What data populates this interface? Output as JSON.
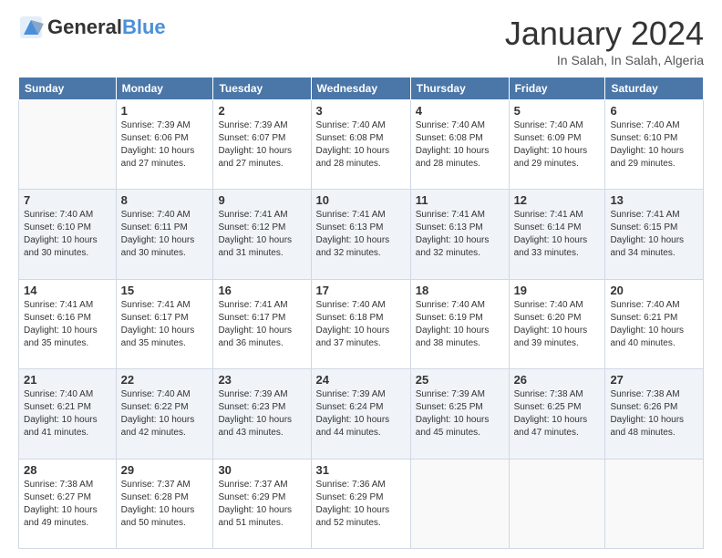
{
  "logo": {
    "text_general": "General",
    "text_blue": "Blue"
  },
  "header": {
    "title": "January 2024",
    "subtitle": "In Salah, In Salah, Algeria"
  },
  "weekdays": [
    "Sunday",
    "Monday",
    "Tuesday",
    "Wednesday",
    "Thursday",
    "Friday",
    "Saturday"
  ],
  "weeks": [
    [
      {
        "day": "",
        "sunrise": "",
        "sunset": "",
        "daylight": ""
      },
      {
        "day": "1",
        "sunrise": "7:39 AM",
        "sunset": "6:06 PM",
        "daylight": "10 hours and 27 minutes."
      },
      {
        "day": "2",
        "sunrise": "7:39 AM",
        "sunset": "6:07 PM",
        "daylight": "10 hours and 27 minutes."
      },
      {
        "day": "3",
        "sunrise": "7:40 AM",
        "sunset": "6:08 PM",
        "daylight": "10 hours and 28 minutes."
      },
      {
        "day": "4",
        "sunrise": "7:40 AM",
        "sunset": "6:08 PM",
        "daylight": "10 hours and 28 minutes."
      },
      {
        "day": "5",
        "sunrise": "7:40 AM",
        "sunset": "6:09 PM",
        "daylight": "10 hours and 29 minutes."
      },
      {
        "day": "6",
        "sunrise": "7:40 AM",
        "sunset": "6:10 PM",
        "daylight": "10 hours and 29 minutes."
      }
    ],
    [
      {
        "day": "7",
        "sunrise": "7:40 AM",
        "sunset": "6:10 PM",
        "daylight": "10 hours and 30 minutes."
      },
      {
        "day": "8",
        "sunrise": "7:40 AM",
        "sunset": "6:11 PM",
        "daylight": "10 hours and 30 minutes."
      },
      {
        "day": "9",
        "sunrise": "7:41 AM",
        "sunset": "6:12 PM",
        "daylight": "10 hours and 31 minutes."
      },
      {
        "day": "10",
        "sunrise": "7:41 AM",
        "sunset": "6:13 PM",
        "daylight": "10 hours and 32 minutes."
      },
      {
        "day": "11",
        "sunrise": "7:41 AM",
        "sunset": "6:13 PM",
        "daylight": "10 hours and 32 minutes."
      },
      {
        "day": "12",
        "sunrise": "7:41 AM",
        "sunset": "6:14 PM",
        "daylight": "10 hours and 33 minutes."
      },
      {
        "day": "13",
        "sunrise": "7:41 AM",
        "sunset": "6:15 PM",
        "daylight": "10 hours and 34 minutes."
      }
    ],
    [
      {
        "day": "14",
        "sunrise": "7:41 AM",
        "sunset": "6:16 PM",
        "daylight": "10 hours and 35 minutes."
      },
      {
        "day": "15",
        "sunrise": "7:41 AM",
        "sunset": "6:17 PM",
        "daylight": "10 hours and 35 minutes."
      },
      {
        "day": "16",
        "sunrise": "7:41 AM",
        "sunset": "6:17 PM",
        "daylight": "10 hours and 36 minutes."
      },
      {
        "day": "17",
        "sunrise": "7:40 AM",
        "sunset": "6:18 PM",
        "daylight": "10 hours and 37 minutes."
      },
      {
        "day": "18",
        "sunrise": "7:40 AM",
        "sunset": "6:19 PM",
        "daylight": "10 hours and 38 minutes."
      },
      {
        "day": "19",
        "sunrise": "7:40 AM",
        "sunset": "6:20 PM",
        "daylight": "10 hours and 39 minutes."
      },
      {
        "day": "20",
        "sunrise": "7:40 AM",
        "sunset": "6:21 PM",
        "daylight": "10 hours and 40 minutes."
      }
    ],
    [
      {
        "day": "21",
        "sunrise": "7:40 AM",
        "sunset": "6:21 PM",
        "daylight": "10 hours and 41 minutes."
      },
      {
        "day": "22",
        "sunrise": "7:40 AM",
        "sunset": "6:22 PM",
        "daylight": "10 hours and 42 minutes."
      },
      {
        "day": "23",
        "sunrise": "7:39 AM",
        "sunset": "6:23 PM",
        "daylight": "10 hours and 43 minutes."
      },
      {
        "day": "24",
        "sunrise": "7:39 AM",
        "sunset": "6:24 PM",
        "daylight": "10 hours and 44 minutes."
      },
      {
        "day": "25",
        "sunrise": "7:39 AM",
        "sunset": "6:25 PM",
        "daylight": "10 hours and 45 minutes."
      },
      {
        "day": "26",
        "sunrise": "7:38 AM",
        "sunset": "6:25 PM",
        "daylight": "10 hours and 47 minutes."
      },
      {
        "day": "27",
        "sunrise": "7:38 AM",
        "sunset": "6:26 PM",
        "daylight": "10 hours and 48 minutes."
      }
    ],
    [
      {
        "day": "28",
        "sunrise": "7:38 AM",
        "sunset": "6:27 PM",
        "daylight": "10 hours and 49 minutes."
      },
      {
        "day": "29",
        "sunrise": "7:37 AM",
        "sunset": "6:28 PM",
        "daylight": "10 hours and 50 minutes."
      },
      {
        "day": "30",
        "sunrise": "7:37 AM",
        "sunset": "6:29 PM",
        "daylight": "10 hours and 51 minutes."
      },
      {
        "day": "31",
        "sunrise": "7:36 AM",
        "sunset": "6:29 PM",
        "daylight": "10 hours and 52 minutes."
      },
      {
        "day": "",
        "sunrise": "",
        "sunset": "",
        "daylight": ""
      },
      {
        "day": "",
        "sunrise": "",
        "sunset": "",
        "daylight": ""
      },
      {
        "day": "",
        "sunrise": "",
        "sunset": "",
        "daylight": ""
      }
    ]
  ],
  "labels": {
    "sunrise": "Sunrise:",
    "sunset": "Sunset:",
    "daylight": "Daylight:"
  }
}
